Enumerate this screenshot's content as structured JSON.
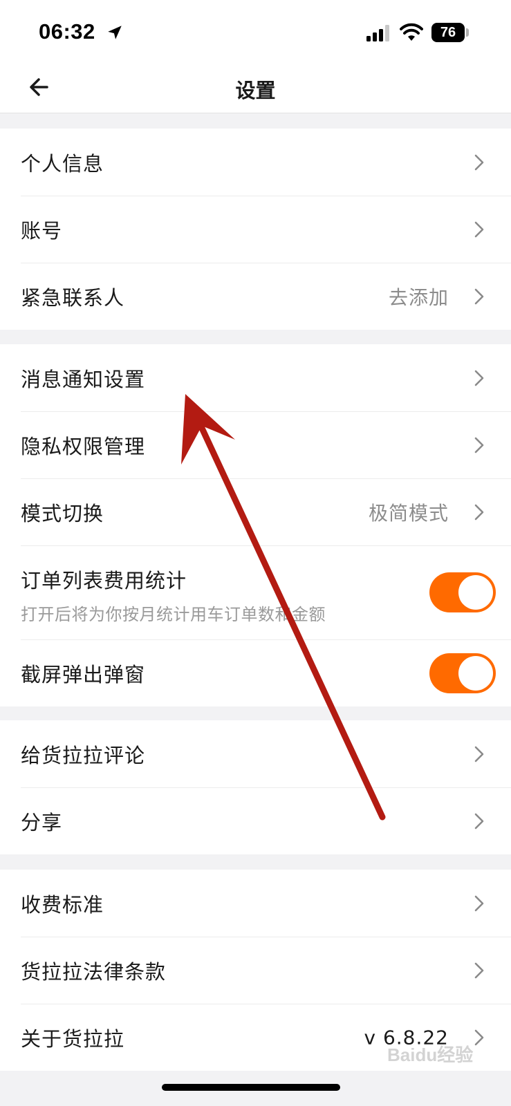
{
  "status_bar": {
    "time": "06:32",
    "battery": "76"
  },
  "header": {
    "title": "设置"
  },
  "groups": [
    {
      "items": [
        {
          "label": "个人信息"
        },
        {
          "label": "账号"
        },
        {
          "label": "紧急联系人",
          "value": "去添加"
        }
      ]
    },
    {
      "items": [
        {
          "label": "消息通知设置"
        },
        {
          "label": "隐私权限管理"
        },
        {
          "label": "模式切换",
          "value": "极简模式"
        },
        {
          "label": "订单列表费用统计",
          "sub": "打开后将为你按月统计用车订单数和金额",
          "toggle": true
        },
        {
          "label": "截屏弹出弹窗",
          "toggle": true
        }
      ]
    },
    {
      "items": [
        {
          "label": "给货拉拉评论"
        },
        {
          "label": "分享"
        }
      ]
    },
    {
      "items": [
        {
          "label": "收费标准"
        },
        {
          "label": "货拉拉法律条款"
        },
        {
          "label": "关于货拉拉",
          "value": "v 6.8.22"
        }
      ]
    }
  ],
  "colors": {
    "accent": "#ff6a00",
    "annotation_arrow": "#b31b12"
  },
  "watermark": "Baidu经验"
}
